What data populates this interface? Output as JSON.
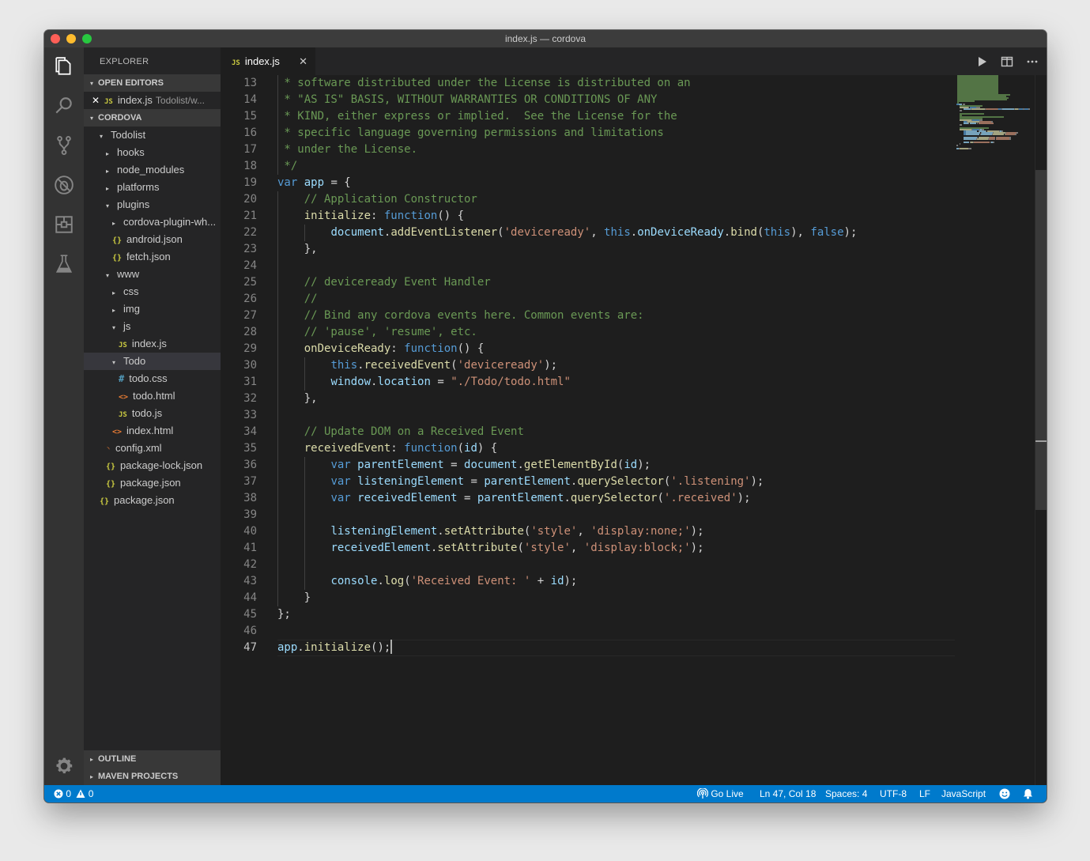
{
  "window": {
    "title": "index.js — cordova"
  },
  "activity_bar": {
    "icons": [
      "files-icon",
      "search-icon",
      "source-control-icon",
      "debug-icon",
      "extensions-icon",
      "test-flask-icon",
      "gear-icon"
    ]
  },
  "sidebar": {
    "title": "EXPLORER",
    "open_editors": {
      "header": "OPEN EDITORS",
      "items": [
        {
          "close": "✕",
          "icon": "JS",
          "name": "index.js",
          "path": "Todolist/w..."
        }
      ]
    },
    "folder": {
      "header": "CORDOVA",
      "tree": [
        {
          "depth": 1,
          "twisty": "▾",
          "icon": "",
          "name": "Todolist"
        },
        {
          "depth": 2,
          "twisty": "▸",
          "icon": "",
          "name": "hooks"
        },
        {
          "depth": 2,
          "twisty": "▸",
          "icon": "",
          "name": "node_modules"
        },
        {
          "depth": 2,
          "twisty": "▸",
          "icon": "",
          "name": "platforms"
        },
        {
          "depth": 2,
          "twisty": "▾",
          "icon": "",
          "name": "plugins"
        },
        {
          "depth": 3,
          "twisty": "▸",
          "icon": "",
          "name": "cordova-plugin-wh..."
        },
        {
          "depth": 3,
          "twisty": "",
          "icon": "{}",
          "name": "android.json"
        },
        {
          "depth": 3,
          "twisty": "",
          "icon": "{}",
          "name": "fetch.json"
        },
        {
          "depth": 2,
          "twisty": "▾",
          "icon": "",
          "name": "www"
        },
        {
          "depth": 3,
          "twisty": "▸",
          "icon": "",
          "name": "css"
        },
        {
          "depth": 3,
          "twisty": "▸",
          "icon": "",
          "name": "img"
        },
        {
          "depth": 3,
          "twisty": "▾",
          "icon": "",
          "name": "js"
        },
        {
          "depth": 4,
          "twisty": "",
          "icon": "JS",
          "name": "index.js"
        },
        {
          "depth": 3,
          "twisty": "▾",
          "icon": "",
          "name": "Todo",
          "selected": true
        },
        {
          "depth": 4,
          "twisty": "",
          "icon": "#",
          "name": "todo.css"
        },
        {
          "depth": 4,
          "twisty": "",
          "icon": "<>",
          "name": "todo.html"
        },
        {
          "depth": 4,
          "twisty": "",
          "icon": "JS",
          "name": "todo.js"
        },
        {
          "depth": 3,
          "twisty": "",
          "icon": "<>",
          "name": "index.html"
        },
        {
          "depth": 2,
          "twisty": "",
          "icon": "rss",
          "name": "config.xml"
        },
        {
          "depth": 2,
          "twisty": "",
          "icon": "{}",
          "name": "package-lock.json"
        },
        {
          "depth": 2,
          "twisty": "",
          "icon": "{}",
          "name": "package.json"
        },
        {
          "depth": 1,
          "twisty": "",
          "icon": "{}",
          "name": "package.json"
        }
      ]
    },
    "bottom_sections": [
      "OUTLINE",
      "MAVEN PROJECTS"
    ]
  },
  "tabs": [
    {
      "icon": "JS",
      "label": "index.js",
      "close": "✕"
    }
  ],
  "editor_actions": [
    "run-icon",
    "split-editor-icon",
    "more-actions-icon"
  ],
  "editor": {
    "first_line": 13,
    "active_line": 47,
    "lines": [
      [
        [
          "c",
          " * software distributed under the License is distributed on an"
        ]
      ],
      [
        [
          "c",
          " * \"AS IS\" BASIS, WITHOUT WARRANTIES OR CONDITIONS OF ANY"
        ]
      ],
      [
        [
          "c",
          " * KIND, either express or implied.  See the License for the"
        ]
      ],
      [
        [
          "c",
          " * specific language governing permissions and limitations"
        ]
      ],
      [
        [
          "c",
          " * under the License."
        ]
      ],
      [
        [
          "c",
          " */"
        ]
      ],
      [
        [
          "k",
          "var "
        ],
        [
          "v",
          "app"
        ],
        [
          "p",
          " = {"
        ]
      ],
      [
        [
          "p",
          "    "
        ],
        [
          "c",
          "// Application Constructor"
        ]
      ],
      [
        [
          "p",
          "    "
        ],
        [
          "f",
          "initialize"
        ],
        [
          "p",
          ": "
        ],
        [
          "k",
          "function"
        ],
        [
          "p",
          "() {"
        ]
      ],
      [
        [
          "p",
          "        "
        ],
        [
          "v",
          "document"
        ],
        [
          "p",
          "."
        ],
        [
          "f",
          "addEventListener"
        ],
        [
          "p",
          "("
        ],
        [
          "s",
          "'deviceready'"
        ],
        [
          "p",
          ", "
        ],
        [
          "k",
          "this"
        ],
        [
          "p",
          "."
        ],
        [
          "v",
          "onDeviceReady"
        ],
        [
          "p",
          "."
        ],
        [
          "f",
          "bind"
        ],
        [
          "p",
          "("
        ],
        [
          "k",
          "this"
        ],
        [
          "p",
          "), "
        ],
        [
          "k",
          "false"
        ],
        [
          "p",
          ");"
        ]
      ],
      [
        [
          "p",
          "    },"
        ]
      ],
      [
        [
          "p",
          ""
        ]
      ],
      [
        [
          "p",
          "    "
        ],
        [
          "c",
          "// deviceready Event Handler"
        ]
      ],
      [
        [
          "p",
          "    "
        ],
        [
          "c",
          "//"
        ]
      ],
      [
        [
          "p",
          "    "
        ],
        [
          "c",
          "// Bind any cordova events here. Common events are:"
        ]
      ],
      [
        [
          "p",
          "    "
        ],
        [
          "c",
          "// 'pause', 'resume', etc."
        ]
      ],
      [
        [
          "p",
          "    "
        ],
        [
          "f",
          "onDeviceReady"
        ],
        [
          "p",
          ": "
        ],
        [
          "k",
          "function"
        ],
        [
          "p",
          "() {"
        ]
      ],
      [
        [
          "p",
          "        "
        ],
        [
          "k",
          "this"
        ],
        [
          "p",
          "."
        ],
        [
          "f",
          "receivedEvent"
        ],
        [
          "p",
          "("
        ],
        [
          "s",
          "'deviceready'"
        ],
        [
          "p",
          ");"
        ]
      ],
      [
        [
          "p",
          "        "
        ],
        [
          "v",
          "window"
        ],
        [
          "p",
          "."
        ],
        [
          "v",
          "location"
        ],
        [
          "p",
          " = "
        ],
        [
          "s",
          "\"./Todo/todo.html\""
        ]
      ],
      [
        [
          "p",
          "    },"
        ]
      ],
      [
        [
          "p",
          ""
        ]
      ],
      [
        [
          "p",
          "    "
        ],
        [
          "c",
          "// Update DOM on a Received Event"
        ]
      ],
      [
        [
          "p",
          "    "
        ],
        [
          "f",
          "receivedEvent"
        ],
        [
          "p",
          ": "
        ],
        [
          "k",
          "function"
        ],
        [
          "p",
          "("
        ],
        [
          "v",
          "id"
        ],
        [
          "p",
          ") {"
        ]
      ],
      [
        [
          "p",
          "        "
        ],
        [
          "k",
          "var "
        ],
        [
          "v",
          "parentElement"
        ],
        [
          "p",
          " = "
        ],
        [
          "v",
          "document"
        ],
        [
          "p",
          "."
        ],
        [
          "f",
          "getElementById"
        ],
        [
          "p",
          "("
        ],
        [
          "v",
          "id"
        ],
        [
          "p",
          ");"
        ]
      ],
      [
        [
          "p",
          "        "
        ],
        [
          "k",
          "var "
        ],
        [
          "v",
          "listeningElement"
        ],
        [
          "p",
          " = "
        ],
        [
          "v",
          "parentElement"
        ],
        [
          "p",
          "."
        ],
        [
          "f",
          "querySelector"
        ],
        [
          "p",
          "("
        ],
        [
          "s",
          "'.listening'"
        ],
        [
          "p",
          ");"
        ]
      ],
      [
        [
          "p",
          "        "
        ],
        [
          "k",
          "var "
        ],
        [
          "v",
          "receivedElement"
        ],
        [
          "p",
          " = "
        ],
        [
          "v",
          "parentElement"
        ],
        [
          "p",
          "."
        ],
        [
          "f",
          "querySelector"
        ],
        [
          "p",
          "("
        ],
        [
          "s",
          "'.received'"
        ],
        [
          "p",
          ");"
        ]
      ],
      [
        [
          "p",
          ""
        ]
      ],
      [
        [
          "p",
          "        "
        ],
        [
          "v",
          "listeningElement"
        ],
        [
          "p",
          "."
        ],
        [
          "f",
          "setAttribute"
        ],
        [
          "p",
          "("
        ],
        [
          "s",
          "'style'"
        ],
        [
          "p",
          ", "
        ],
        [
          "s",
          "'display:none;'"
        ],
        [
          "p",
          ");"
        ]
      ],
      [
        [
          "p",
          "        "
        ],
        [
          "v",
          "receivedElement"
        ],
        [
          "p",
          "."
        ],
        [
          "f",
          "setAttribute"
        ],
        [
          "p",
          "("
        ],
        [
          "s",
          "'style'"
        ],
        [
          "p",
          ", "
        ],
        [
          "s",
          "'display:block;'"
        ],
        [
          "p",
          ");"
        ]
      ],
      [
        [
          "p",
          ""
        ]
      ],
      [
        [
          "p",
          "        "
        ],
        [
          "v",
          "console"
        ],
        [
          "p",
          "."
        ],
        [
          "f",
          "log"
        ],
        [
          "p",
          "("
        ],
        [
          "s",
          "'Received Event: '"
        ],
        [
          "p",
          " + "
        ],
        [
          "v",
          "id"
        ],
        [
          "p",
          ");"
        ]
      ],
      [
        [
          "p",
          "    }"
        ]
      ],
      [
        [
          "p",
          "};"
        ]
      ],
      [
        [
          "p",
          ""
        ]
      ],
      [
        [
          "v",
          "app"
        ],
        [
          "p",
          "."
        ],
        [
          "f",
          "initialize"
        ],
        [
          "p",
          "();"
        ]
      ]
    ]
  },
  "statusbar": {
    "errors": "0",
    "warnings": "0",
    "go_live": "Go Live",
    "position": "Ln 47, Col 18",
    "spaces": "Spaces: 4",
    "encoding": "UTF-8",
    "eol": "LF",
    "language": "JavaScript"
  },
  "colors": {
    "statusbar": "#007acc",
    "activitybar": "#333333",
    "sidebar": "#252526",
    "editor": "#1e1e1e"
  }
}
